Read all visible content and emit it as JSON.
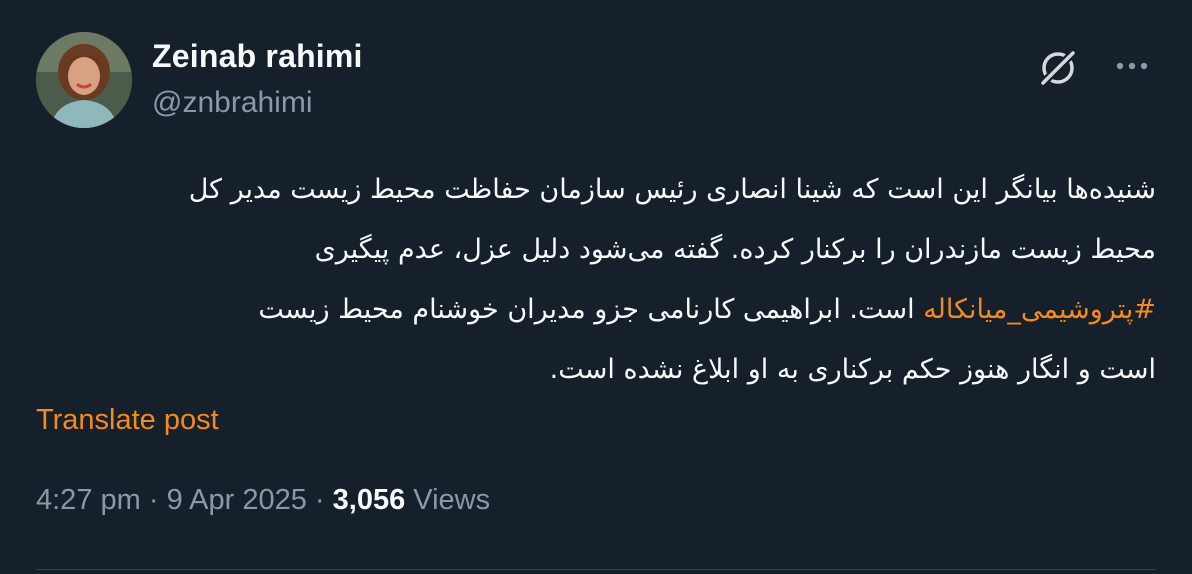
{
  "author": {
    "display_name": "Zeinab rahimi",
    "handle": "@znbrahimi",
    "avatar_icon": "profile-photo"
  },
  "header": {
    "grok_icon": "grok-icon",
    "more_icon": "more-icon"
  },
  "tweet": {
    "line1": "شنیده‌ها بیانگر این است که شینا انصاری رئیس سازمان حفاظت محیط زیست مدیر کل",
    "line2": "محیط زیست مازندران را برکنار کرده. گفته می‌شود دلیل عزل، عدم پیگیری",
    "line3_hashtag": "#پتروشیمی_میانکاله",
    "line3_rest": " است. ابراهیمی کارنامی جزو مدیران خوشنام محیط زیست",
    "line4": "است و انگار هنوز حکم برکناری به او ابلاغ نشده است."
  },
  "translate_label": "Translate post",
  "meta": {
    "time": "4:27 pm",
    "sep1": " · ",
    "date": "9 Apr 2025",
    "sep2": " · ",
    "views_count": "3,056",
    "views_label": " Views"
  },
  "colors": {
    "background": "#15202b",
    "text_primary": "#f7f9f9",
    "text_secondary": "#8b98a5",
    "accent": "#f4891f",
    "divider": "#38444d"
  }
}
